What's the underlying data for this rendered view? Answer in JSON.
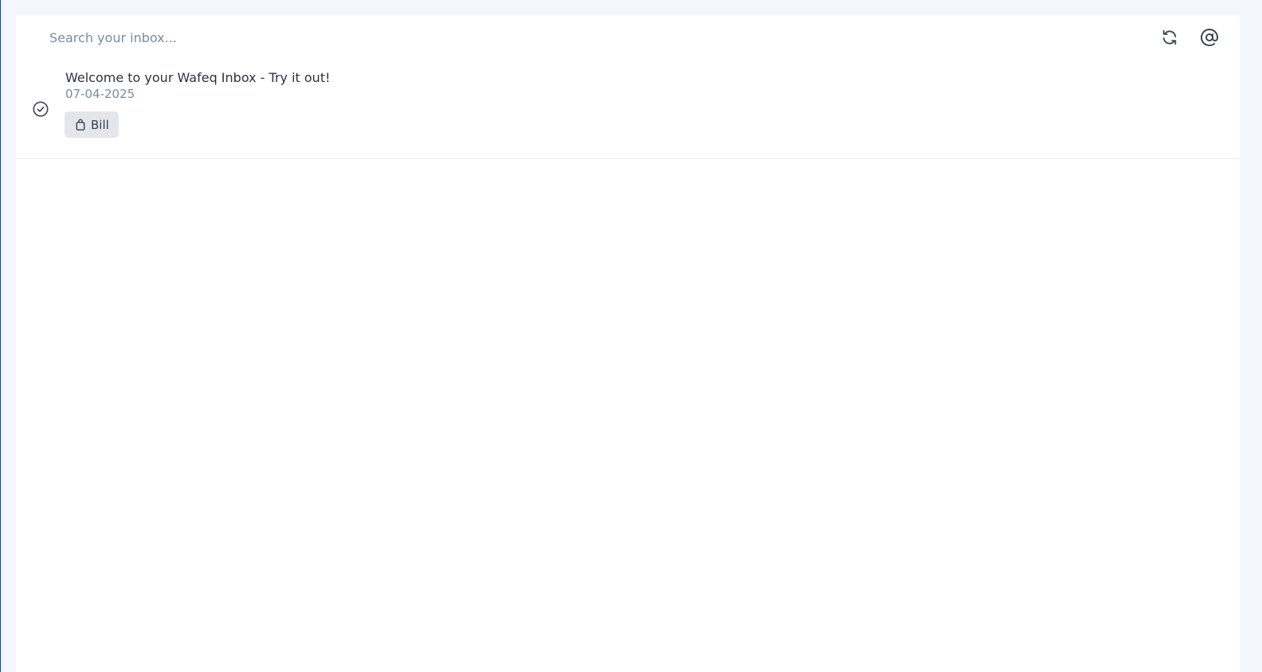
{
  "search": {
    "placeholder": "Search your inbox..."
  },
  "toolbar": {
    "refresh_icon": "refresh-icon",
    "email_icon": "at-sign-icon"
  },
  "inbox": {
    "items": [
      {
        "title": "Welcome to your Wafeq Inbox - Try it out!",
        "date": "07-04-2025",
        "tag": "Bill",
        "tag_icon": "shopping-bag-icon",
        "status_icon": "check-circle-icon"
      }
    ]
  },
  "colors": {
    "background": "#f3f7fb",
    "panel": "#ffffff",
    "muted_text": "#7a8ca3",
    "text": "#2b3340",
    "tag_bg": "#e4e6ea"
  }
}
